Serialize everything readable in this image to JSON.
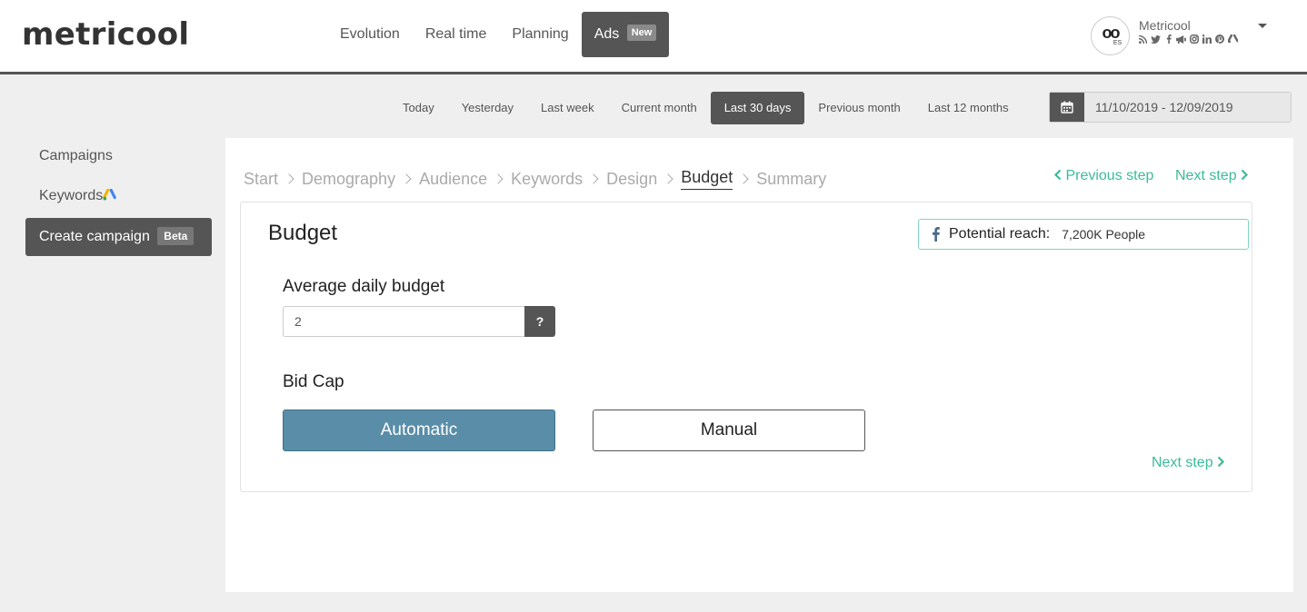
{
  "brand": {
    "logo": "metricool",
    "accent": "#3dba9a",
    "dark": "#555555"
  },
  "nav": {
    "items": [
      "Evolution",
      "Real time",
      "Planning"
    ],
    "active": {
      "label": "Ads",
      "badge": "New"
    }
  },
  "account": {
    "name": "Metricool",
    "avatar_text": "oo",
    "avatar_lang": "ES",
    "networks": [
      "rss-icon",
      "twitter-icon",
      "facebook-icon",
      "megaphone-icon",
      "instagram-icon",
      "linkedin-icon",
      "pinterest-icon",
      "google-ads-icon"
    ]
  },
  "ranges": {
    "items": [
      "Today",
      "Yesterday",
      "Last week",
      "Current month",
      "Last 30 days",
      "Previous month",
      "Last 12 months"
    ],
    "active": "Last 30 days",
    "date_value": "11/10/2019 - 12/09/2019"
  },
  "sidebar": {
    "items": [
      {
        "label": "Campaigns"
      },
      {
        "label": "Keywords"
      },
      {
        "label": "Create campaign",
        "badge": "Beta"
      }
    ]
  },
  "wizard": {
    "steps": [
      "Start",
      "Demography",
      "Audience",
      "Keywords",
      "Design",
      "Budget",
      "Summary"
    ],
    "current": "Budget",
    "prev_label": "Previous step",
    "next_label": "Next step"
  },
  "budget": {
    "title": "Budget",
    "reach_label": "Potential reach:",
    "reach_value": "7,200K People",
    "daily_label": "Average daily budget",
    "daily_value": "2",
    "help_label": "?",
    "bidcap_label": "Bid Cap",
    "option_auto": "Automatic",
    "option_manual": "Manual",
    "next_label": "Next step"
  }
}
